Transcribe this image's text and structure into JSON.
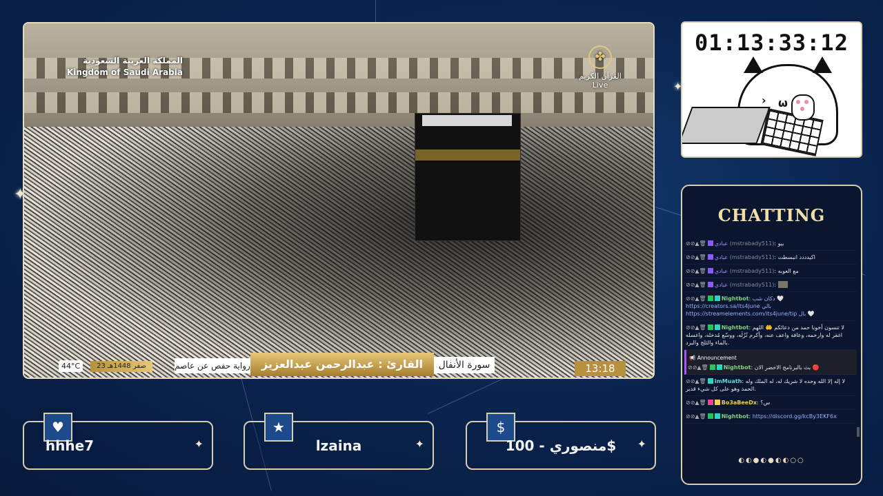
{
  "video": {
    "ksa_ar": "المملكة العربية السعودية",
    "ksa_en": "Kingdom of Saudi Arabia",
    "channel_ar": "القرآن الكريم",
    "live": "Live",
    "temperature": "44°C",
    "date": "23 صفر 1448هـ",
    "riwaya": "رواية حفص عن عاصم",
    "reciter": "القارئ : عبدالرحمن عبدالعزيز السديس",
    "surah": "سورة الأنفال",
    "time": "13:18"
  },
  "timer": {
    "value": "01:13:33:12"
  },
  "chat": {
    "title": "CHATTING",
    "messages": [
      {
        "user": "عبادي",
        "handle": "(mstrabady511)",
        "text": "بيو"
      },
      {
        "user": "عبادي",
        "handle": "(mstrabady511)",
        "text": "اكيدددد انبسطت"
      },
      {
        "user": "عبادي",
        "handle": "(mstrabady511)",
        "text": "مع العوبه"
      },
      {
        "user": "عبادي",
        "handle": "(mstrabady511)",
        "text": ""
      },
      {
        "user": "Nightbot",
        "text": "دكان شب 🤍 https://creators.sa/its4june بالي https://streamelements.com/its4june/tip بال 🤍"
      },
      {
        "user": "Nightbot",
        "text": "لا تنسون أخونا حمد من دعائكم 🤲 اللهم اغفر له وارحمه، وعافه واعف عنه، وأكرم نُزُلَه، ووسّع مُدخله، واغسله بالماء والثلج والبرد."
      },
      {
        "announcement": "Announcement",
        "user": "Nightbot",
        "text": "بث بالبرنامج الاخضر الان 🔴"
      },
      {
        "user": "imMuath",
        "text": "لا إله إلا الله وحده لا شريك له، له الملك وله الحمد وهو على كل شيء قدير."
      },
      {
        "user": "Bo3aBeeDx",
        "text": "س؟"
      },
      {
        "user": "Nightbot",
        "text": "https://discord.gg/kcBy3EKF6x"
      }
    ],
    "pager": "◐◐●◐●◐◐○○"
  },
  "panels": [
    {
      "icon": "heart-icon",
      "glyph": "♥",
      "label": "hhhe7"
    },
    {
      "icon": "star-icon",
      "glyph": "★",
      "label": "lzaina"
    },
    {
      "icon": "dollar-icon",
      "glyph": "$",
      "label": "منصوري - 100$"
    }
  ]
}
